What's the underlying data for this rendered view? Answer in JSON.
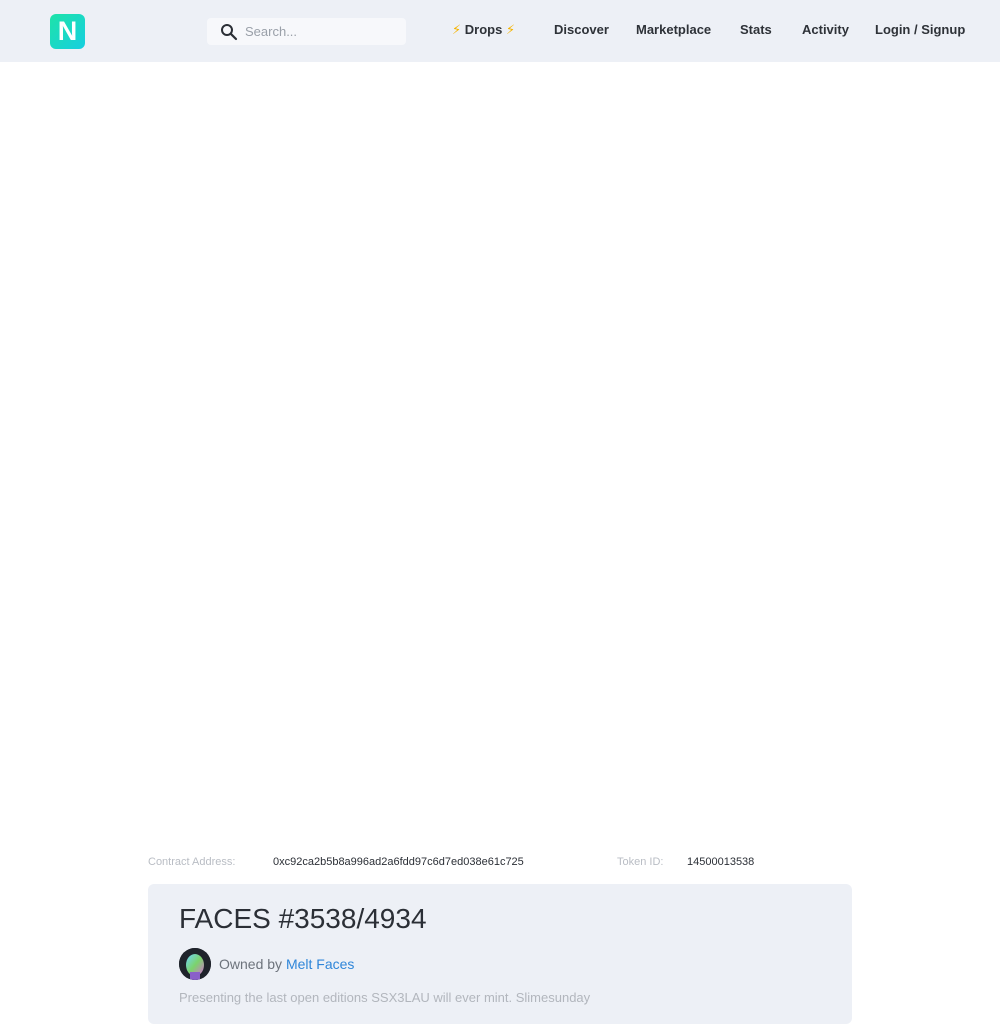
{
  "header": {
    "logo_letter": "N",
    "search": {
      "placeholder": "Search..."
    },
    "nav": {
      "drops_bolt_left": "⚡",
      "drops_label": "Drops",
      "drops_bolt_right": "⚡",
      "discover": "Discover",
      "marketplace": "Marketplace",
      "stats": "Stats",
      "activity": "Activity",
      "login": "Login / Signup"
    }
  },
  "token_meta": {
    "contract_label": "Contract Address:",
    "contract_value": "0xc92ca2b5b8a996ad2a6fdd97c6d7ed038e61c725",
    "token_label": "Token ID:",
    "token_value": "14500013538"
  },
  "details": {
    "title": "FACES #3538/4934",
    "owned_prefix": "Owned by",
    "owner_name": "Melt Faces",
    "description": "Presenting the last open editions SSX3LAU will ever mint. Slimesunday"
  },
  "colors": {
    "accent": "#1ee3a8",
    "link": "#2f86d9",
    "header_bg": "#edf0f6",
    "bolt": "#f5b400"
  }
}
